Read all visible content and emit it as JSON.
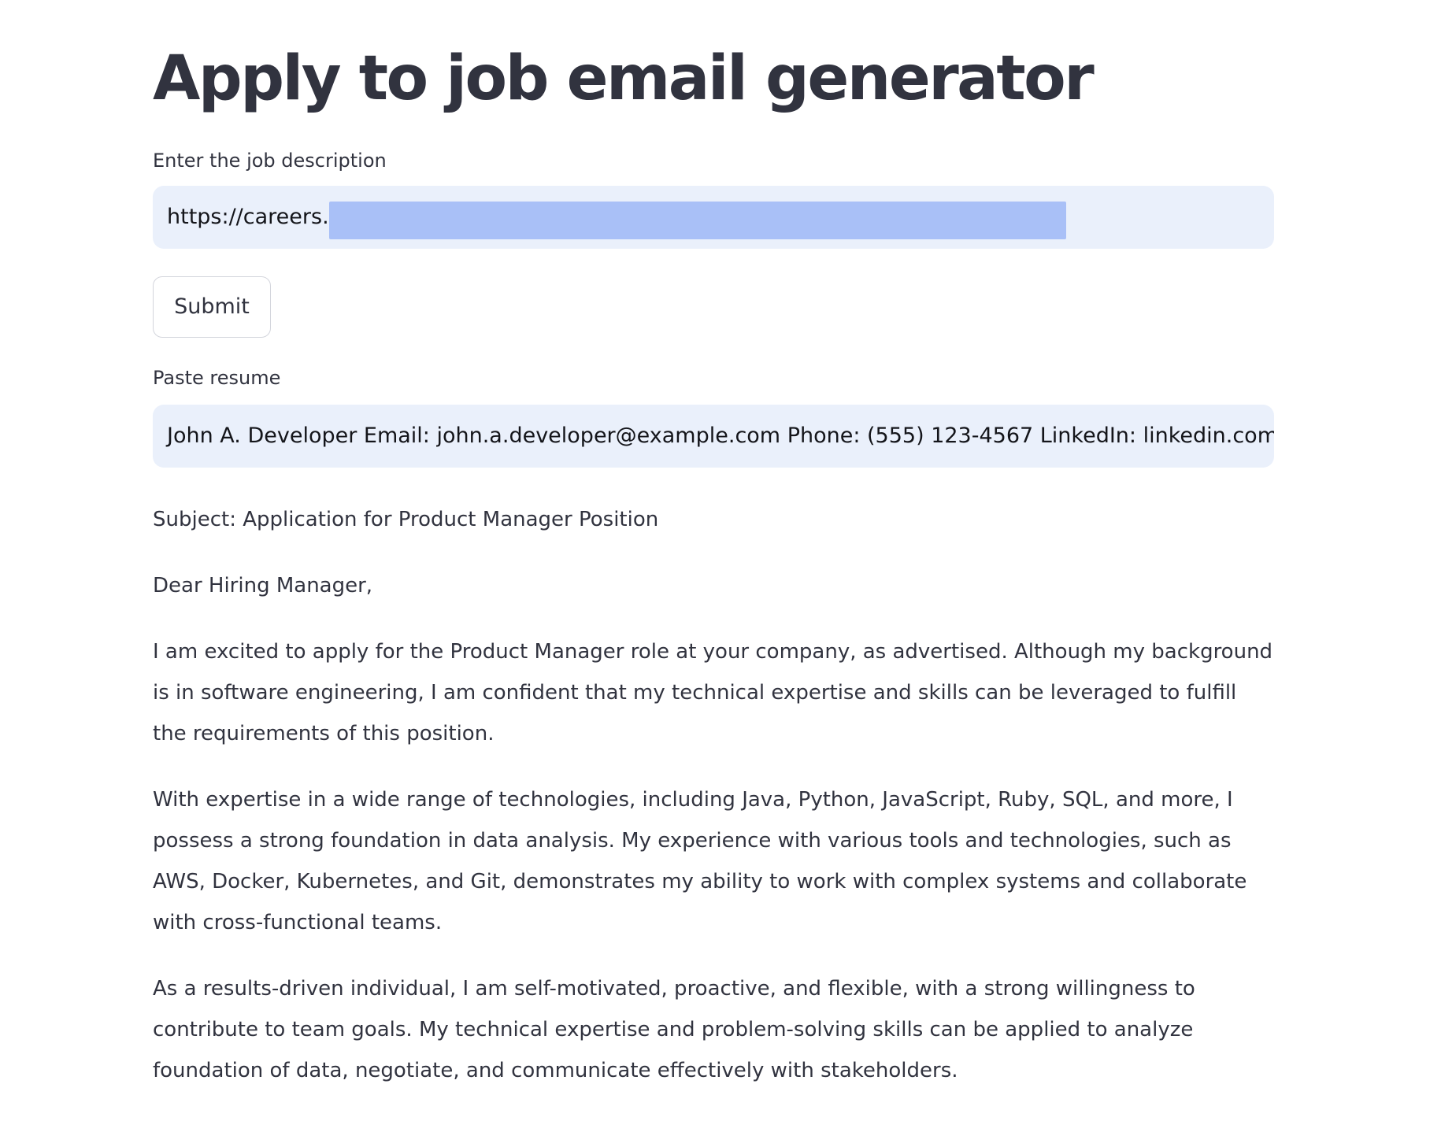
{
  "header": {
    "title": "Apply to job email generator"
  },
  "job_description": {
    "label": "Enter the job description",
    "value": "https://careers."
  },
  "submit": {
    "label": "Submit"
  },
  "resume": {
    "label": "Paste resume",
    "value": "John A. Developer Email: john.a.developer@example.com Phone: (555) 123-4567 LinkedIn: linkedin.com"
  },
  "email": {
    "subject": "Subject: Application for Product Manager Position",
    "greeting": "Dear Hiring Manager,",
    "paragraphs": [
      "I am excited to apply for the Product Manager role at your company, as advertised. Although my background is in software engineering, I am confident that my technical expertise and skills can be leveraged to fulfill the requirements of this position.",
      "With expertise in a wide range of technologies, including Java, Python, JavaScript, Ruby, SQL, and more, I possess a strong foundation in data analysis. My experience with various tools and technologies, such as AWS, Docker, Kubernetes, and Git, demonstrates my ability to work with complex systems and collaborate with cross-functional teams.",
      "As a results-driven individual, I am self-motivated, proactive, and flexible, with a strong willingness to contribute to team goals. My technical expertise and problem-solving skills can be applied to analyze foundation of data, negotiate, and communicate effectively with stakeholders."
    ]
  }
}
